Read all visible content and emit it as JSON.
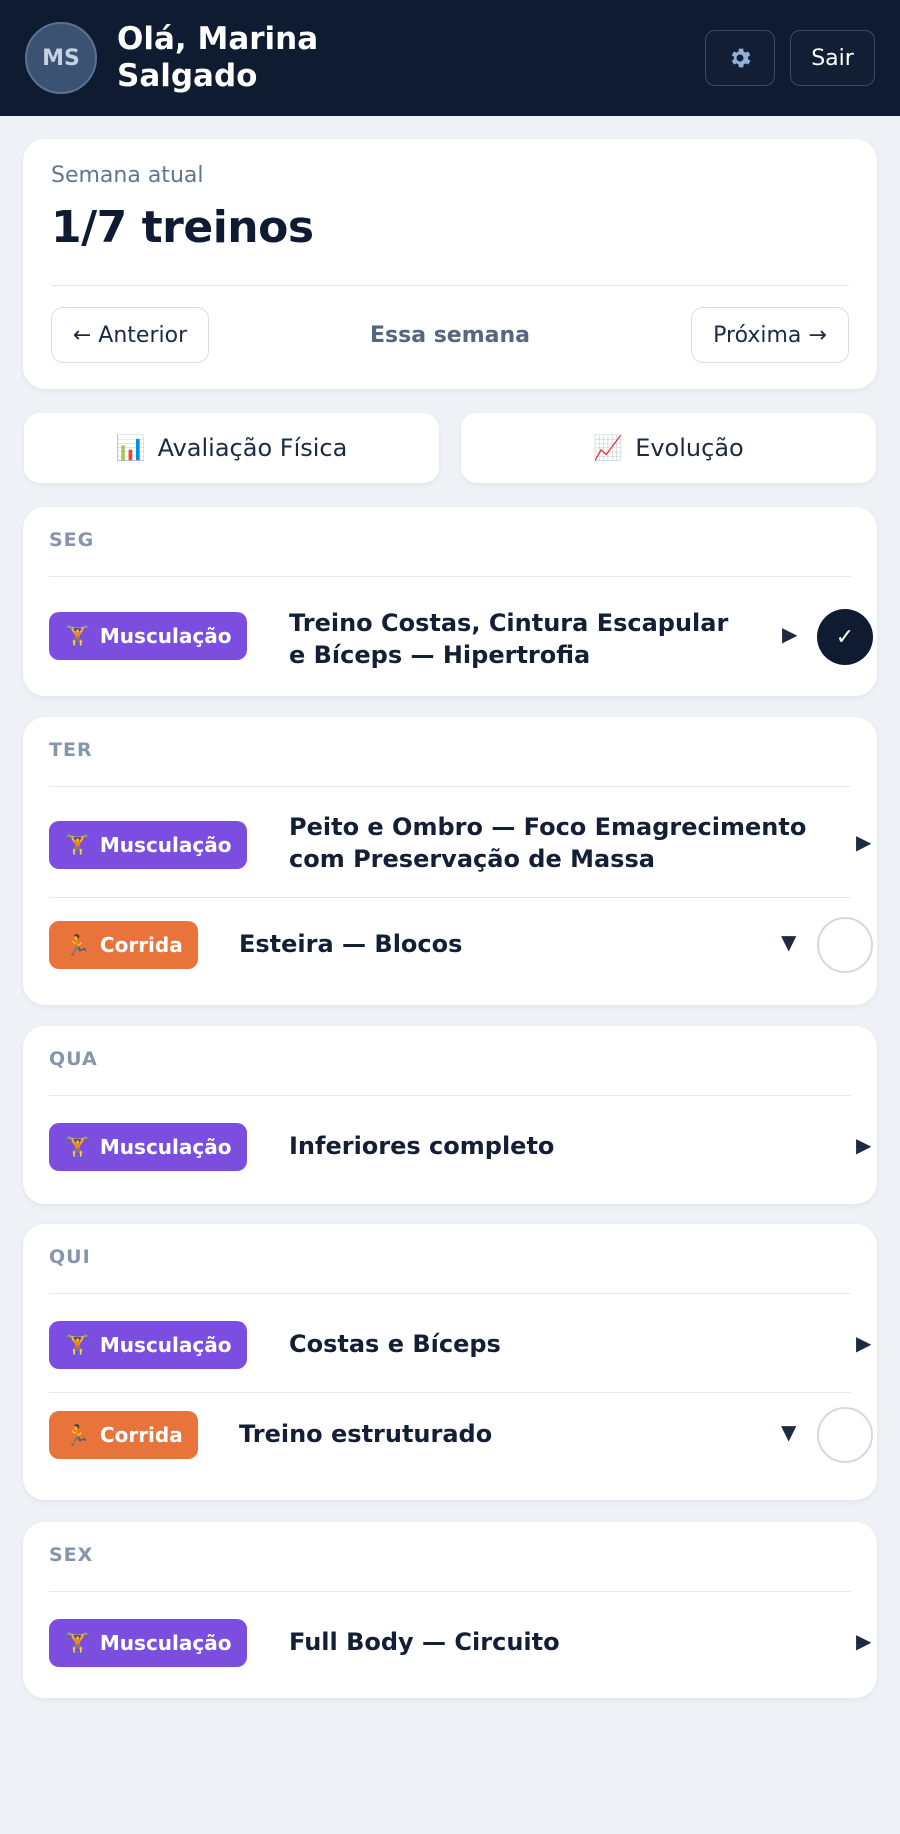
{
  "header": {
    "avatar_initials": "MS",
    "greeting": "Olá, Marina Salgado",
    "settings_icon": "gear-icon",
    "logout_label": "Sair"
  },
  "week": {
    "label": "Semana atual",
    "count": "1/7 treinos",
    "prev_label": "← Anterior",
    "current_label": "Essa semana",
    "next_label": "Próxima →"
  },
  "quick_actions": {
    "assessment_icon": "📊",
    "assessment_label": "Avaliação Física",
    "evolution_icon": "📈",
    "evolution_label": "Evolução"
  },
  "badges": {
    "strength_icon": "🏋",
    "strength_label": "Musculação",
    "run_icon": "🏃",
    "run_label": "Corrida"
  },
  "days": [
    {
      "label": "SEG",
      "items": [
        {
          "type": "Musculação",
          "title": "Treino Costas, Cintura Escapular e Bíceps — Hipertrofia",
          "expand": "▶",
          "done": true,
          "check": "✓"
        }
      ]
    },
    {
      "label": "TER",
      "items": [
        {
          "type": "Musculação",
          "title": "Peito e Ombro — Foco Emagrecimento com Preservação de Massa",
          "expand": "▶"
        },
        {
          "type": "Corrida",
          "title": "Esteira — Blocos",
          "expand": "▼",
          "done": false
        }
      ]
    },
    {
      "label": "QUA",
      "items": [
        {
          "type": "Musculação",
          "title": "Inferiores completo",
          "expand": "▶"
        }
      ]
    },
    {
      "label": "QUI",
      "items": [
        {
          "type": "Musculação",
          "title": "Costas e Bíceps",
          "expand": "▶"
        },
        {
          "type": "Corrida",
          "title": "Treino estruturado",
          "expand": "▼",
          "done": false
        }
      ]
    },
    {
      "label": "SEX",
      "items": [
        {
          "type": "Musculação",
          "title": "Full Body — Circuito",
          "expand": "▶"
        }
      ]
    }
  ],
  "colors": {
    "header_bg": "#0f1b30",
    "strength_badge": "#7b4ee0",
    "run_badge": "#e8733b",
    "page_bg": "#eef2f7"
  }
}
